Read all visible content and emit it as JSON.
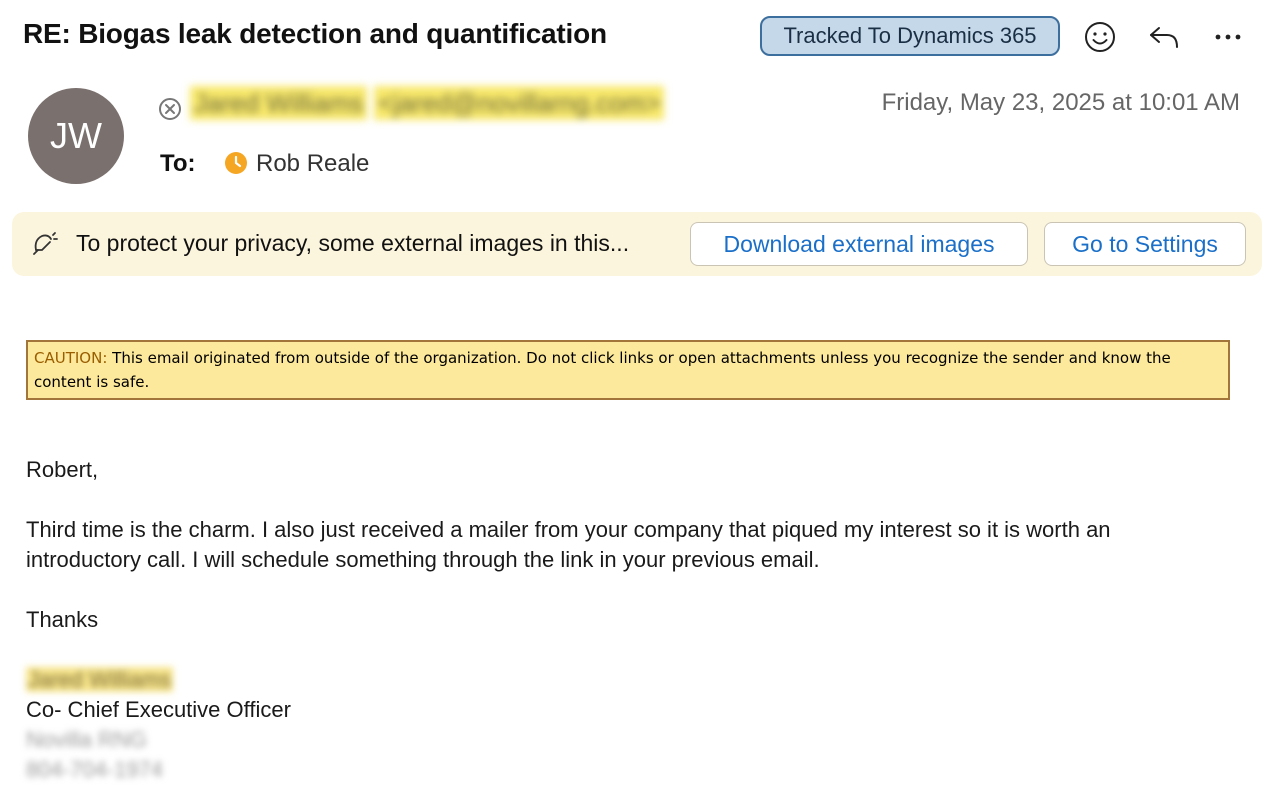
{
  "header": {
    "subject": "RE: Biogas leak detection and quantification",
    "tracked_badge": "Tracked To Dynamics 365",
    "icons": [
      "smiley-icon",
      "reply-icon",
      "more-icon"
    ]
  },
  "sender": {
    "initials": "JW",
    "name": "Jared Williams",
    "email": "<jared@novillarng.com>",
    "date": "Friday, May 23, 2025 at 10:01 AM",
    "to_label": "To:",
    "recipient": "Rob Reale"
  },
  "privacy": {
    "message": "To protect your privacy, some external images in this...",
    "download_button": "Download external images",
    "settings_button": "Go to Settings"
  },
  "caution": {
    "label": "CAUTION:",
    "text": "This email originated from outside of the organization. Do not click links or open attachments unless you recognize the sender and know the content is safe."
  },
  "body": {
    "greeting": "Robert,",
    "paragraph1": "Third time is the charm.  I also just received a mailer from your company that piqued my interest so it is worth an introductory call.  I will schedule something through the link in your previous email.",
    "closing": "Thanks"
  },
  "signature": {
    "name": "Jared Williams",
    "title": "Co- Chief Executive Officer",
    "company": "Novilla RNG",
    "phone": "804-704-1974"
  },
  "colors": {
    "badge_bg": "#c5d8ea",
    "badge_border": "#3d6f9e",
    "avatar_bg": "#7a706d",
    "privacy_bg": "#fcf5dd",
    "link_blue": "#1a6fc8",
    "caution_bg": "#fde99b",
    "caution_border": "#a2753a",
    "caution_label": "#9a5d00",
    "recipient_icon": "#f5a623"
  }
}
